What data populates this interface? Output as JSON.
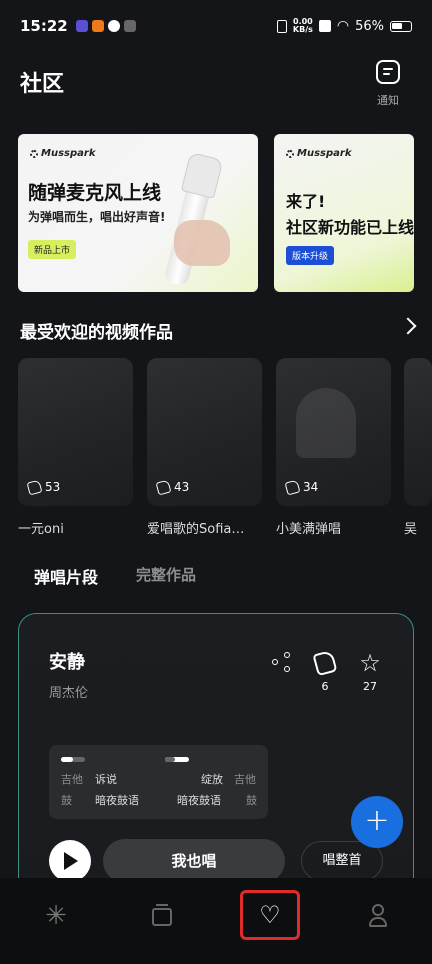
{
  "status": {
    "time": "15:22",
    "speed_value": "0.00",
    "speed_unit": "KB/s",
    "battery": "56%"
  },
  "header": {
    "title": "社区",
    "notify_label": "通知"
  },
  "banners": [
    {
      "brand": "Musspark",
      "headline": "随弹麦克风上线",
      "subtitle": "为弹唱而生，唱出好声音!",
      "tag": "新品上市"
    },
    {
      "brand": "Musspark",
      "headline1": "来了!",
      "headline2": "社区新功能已上线",
      "tag": "版本升级"
    }
  ],
  "popular": {
    "title": "最受欢迎的视频作品",
    "items": [
      {
        "name": "一元oni",
        "likes": "53"
      },
      {
        "name": "爱唱歌的Sofia…",
        "likes": "43"
      },
      {
        "name": "小美满弹唱",
        "likes": "34"
      },
      {
        "name": "吴"
      }
    ]
  },
  "tabs": {
    "active": "弹唱片段",
    "inactive": "完整作品"
  },
  "song": {
    "title": "安静",
    "artist": "周杰伦",
    "claps": "6",
    "stars": "27",
    "tracks": {
      "left_guitar": "吉他",
      "left_guitar_val": "诉说",
      "left_drum": "鼓",
      "left_drum_val": "暗夜鼓语",
      "right_guitar_val": "绽放",
      "right_guitar": "吉他",
      "right_drum_val": "暗夜鼓语",
      "right_drum": "鼓"
    },
    "sing_label": "我也唱",
    "whole_label": "唱整首"
  },
  "fab": {
    "label": "+"
  },
  "colors": {
    "accent": "#1a6fe0",
    "highlight": "#e02b2b",
    "tag_green": "#d7ef5f",
    "tag_blue": "#1c4fd6"
  },
  "icons": [
    "search-icon",
    "bell-icon"
  ]
}
